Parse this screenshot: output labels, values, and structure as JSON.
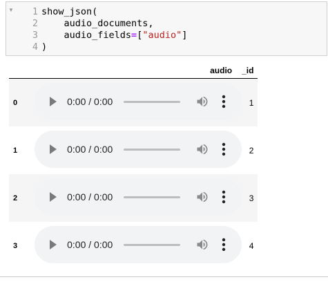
{
  "code_cell": {
    "line_numbers": [
      "1",
      "2",
      "3",
      "4"
    ],
    "lines": [
      {
        "parts": [
          {
            "t": "show_json(",
            "c": ""
          }
        ]
      },
      {
        "parts": [
          {
            "t": "    audio_documents,",
            "c": ""
          }
        ]
      },
      {
        "parts": [
          {
            "t": "    audio_fields",
            "c": ""
          },
          {
            "t": "=",
            "c": "tok-op"
          },
          {
            "t": "[",
            "c": ""
          },
          {
            "t": "\"audio\"",
            "c": "tok-str"
          },
          {
            "t": "]",
            "c": ""
          }
        ]
      },
      {
        "parts": [
          {
            "t": ")",
            "c": ""
          }
        ]
      }
    ]
  },
  "output_table": {
    "columns": [
      "",
      "audio",
      "_id"
    ],
    "rows": [
      {
        "index": "0",
        "time": "0:00 / 0:00",
        "id": "1"
      },
      {
        "index": "1",
        "time": "0:00 / 0:00",
        "id": "2"
      },
      {
        "index": "2",
        "time": "0:00 / 0:00",
        "id": "3"
      },
      {
        "index": "3",
        "time": "0:00 / 0:00",
        "id": "4"
      }
    ]
  },
  "icons": {
    "fold": "fold-arrow-icon",
    "play": "play-icon",
    "volume": "volume-icon",
    "menu": "more-vert-icon"
  },
  "colors": {
    "code_bg": "#f7f7f7",
    "string": "#ba2121",
    "operator": "#aa22ff",
    "player_bg": "#f1f3f4",
    "row_stripe": "#f5f5f5"
  }
}
